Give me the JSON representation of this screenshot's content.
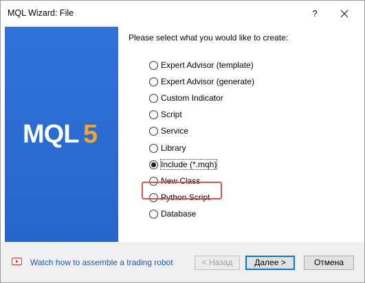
{
  "window": {
    "title": "MQL Wizard: File",
    "help_label": "?"
  },
  "banner": {
    "logo_text": "MQL5"
  },
  "prompt": "Please select what you would like to create:",
  "options": [
    {
      "label": "Expert Advisor (template)",
      "selected": false
    },
    {
      "label": "Expert Advisor (generate)",
      "selected": false
    },
    {
      "label": "Custom Indicator",
      "selected": false
    },
    {
      "label": "Script",
      "selected": false
    },
    {
      "label": "Service",
      "selected": false
    },
    {
      "label": "Library",
      "selected": false
    },
    {
      "label": "Include (*.mqh)",
      "selected": true
    },
    {
      "label": "New Class",
      "selected": false
    },
    {
      "label": "Python Script",
      "selected": false
    },
    {
      "label": "Database",
      "selected": false
    }
  ],
  "footer": {
    "watch_link": "Watch how to assemble a trading robot",
    "back_label": "< Назад",
    "next_label": "Далее >",
    "cancel_label": "Отмена"
  },
  "colors": {
    "banner": "#2a6bd4",
    "highlight": "#d9534f",
    "link": "#1a56c8",
    "logo_accent": "#f5a623"
  }
}
